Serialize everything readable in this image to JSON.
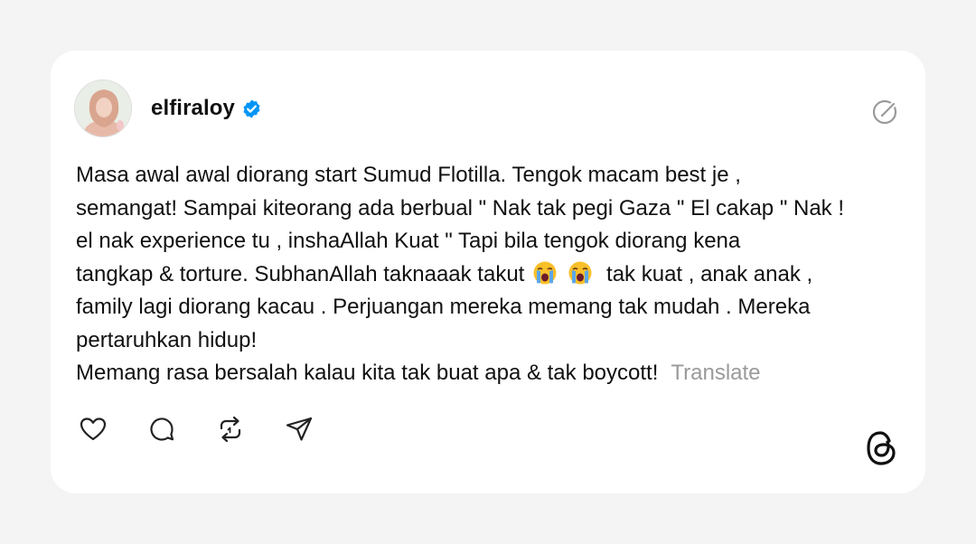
{
  "post": {
    "username": "elfiraloy",
    "verified": true,
    "text_lines": [
      "Masa awal awal diorang start Sumud Flotilla. Tengok macam best je ,",
      "semangat! Sampai kiteorang ada berbual \" Nak tak pegi Gaza \" El cakap \" Nak !",
      "el nak experience tu , inshaAllah Kuat \" Tapi bila tengok diorang kena",
      "tangkap & torture. SubhanAllah taknaaak takut",
      "tak kuat , anak anak ,",
      "family lagi diorang kacau . Perjuangan mereka memang tak mudah . Mereka",
      "pertaruhkan hidup!",
      "Memang rasa bersalah kalau kita tak buat apa & tak boycott!"
    ],
    "emoji": "loudly-crying-face",
    "translate_label": "Translate"
  },
  "icons": {
    "like": "heart-icon",
    "reply": "comment-icon",
    "repost": "repost-icon",
    "share": "send-icon",
    "brand": "threads-logo-icon"
  },
  "colors": {
    "background": "#f4f4f4",
    "card": "#ffffff",
    "text": "#111111",
    "muted": "#9a9a9a",
    "verified": "#0095f6"
  }
}
